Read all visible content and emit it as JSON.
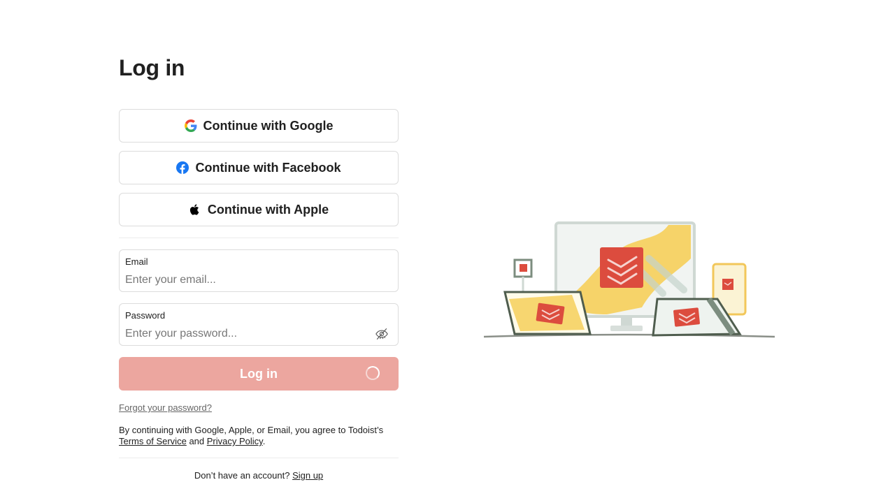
{
  "page": {
    "title": "Log in"
  },
  "oauth": {
    "google_label": "Continue with Google",
    "facebook_label": "Continue with Facebook",
    "apple_label": "Continue with Apple",
    "google_icon": "google-icon",
    "facebook_icon": "facebook-icon",
    "apple_icon": "apple-icon"
  },
  "form": {
    "email": {
      "label": "Email",
      "placeholder": "Enter your email...",
      "value": ""
    },
    "password": {
      "label": "Password",
      "placeholder": "Enter your password...",
      "value": "",
      "toggle_icon": "eye-slash-icon"
    },
    "submit_label": "Log in",
    "submit_state": "loading",
    "forgot_label": "Forgot your password?"
  },
  "legal": {
    "prefix": "By continuing with Google, Apple, or Email, you agree to Todoist’s",
    "terms_label": "Terms of Service",
    "and": "and",
    "privacy_label": "Privacy Policy",
    "suffix": "."
  },
  "signup": {
    "prompt": "Don’t have an account?",
    "link_label": "Sign up"
  },
  "colors": {
    "accent": "#dc4c3e",
    "button_disabled": "#eca69f",
    "border": "#dcdcdc",
    "text": "#202020"
  }
}
